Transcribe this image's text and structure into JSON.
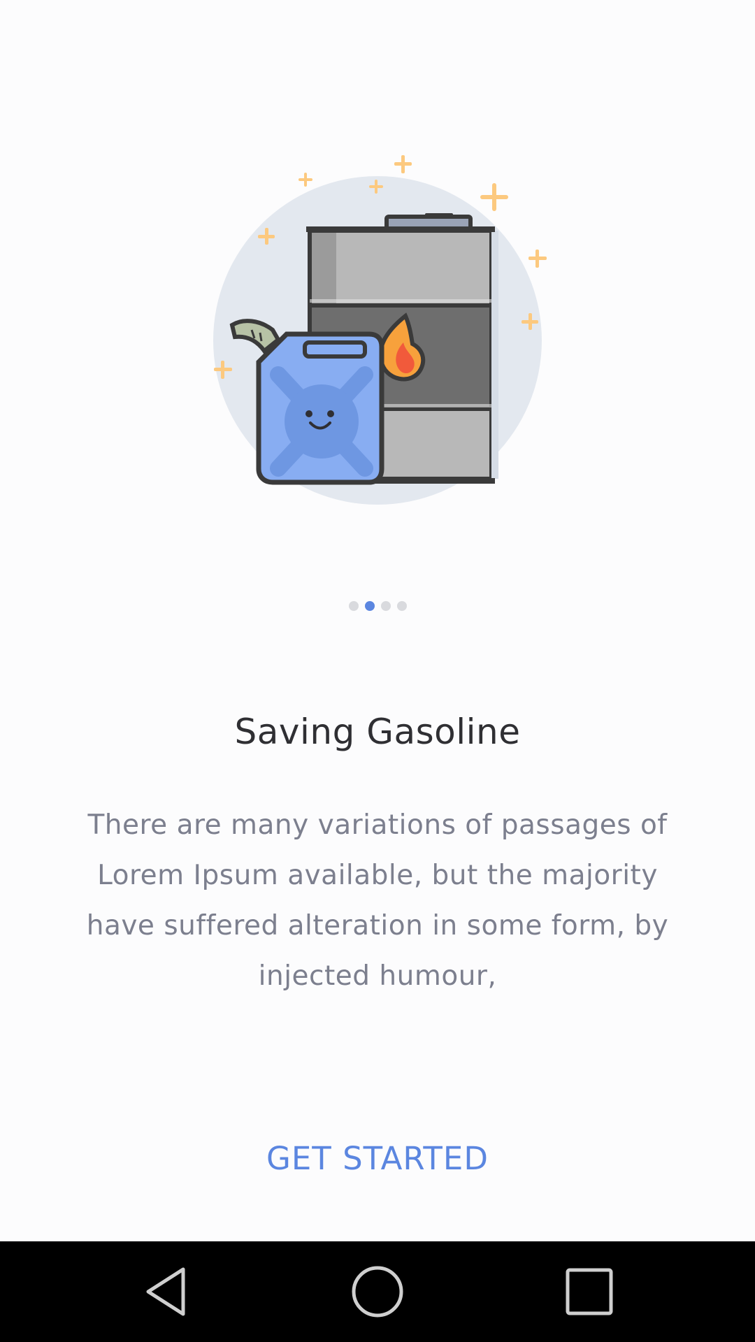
{
  "onboarding": {
    "illustration": "jerrycan-and-fuel-barrel-illustration",
    "pager": {
      "count": 4,
      "active_index": 1
    },
    "title": "Saving Gasoline",
    "body": "There are many variations of passages of Lorem Ipsum available, but the majority have suffered alteration in some form, by injected humour,",
    "cta_label": "GET STARTED"
  },
  "navbar": {
    "back_icon": "back-triangle-icon",
    "home_icon": "home-circle-icon",
    "recents_icon": "recents-square-icon"
  },
  "colors": {
    "accent": "#5b86e0",
    "title": "#2f2f33",
    "body": "#7c7f8e",
    "dot_inactive": "#d9dade"
  }
}
